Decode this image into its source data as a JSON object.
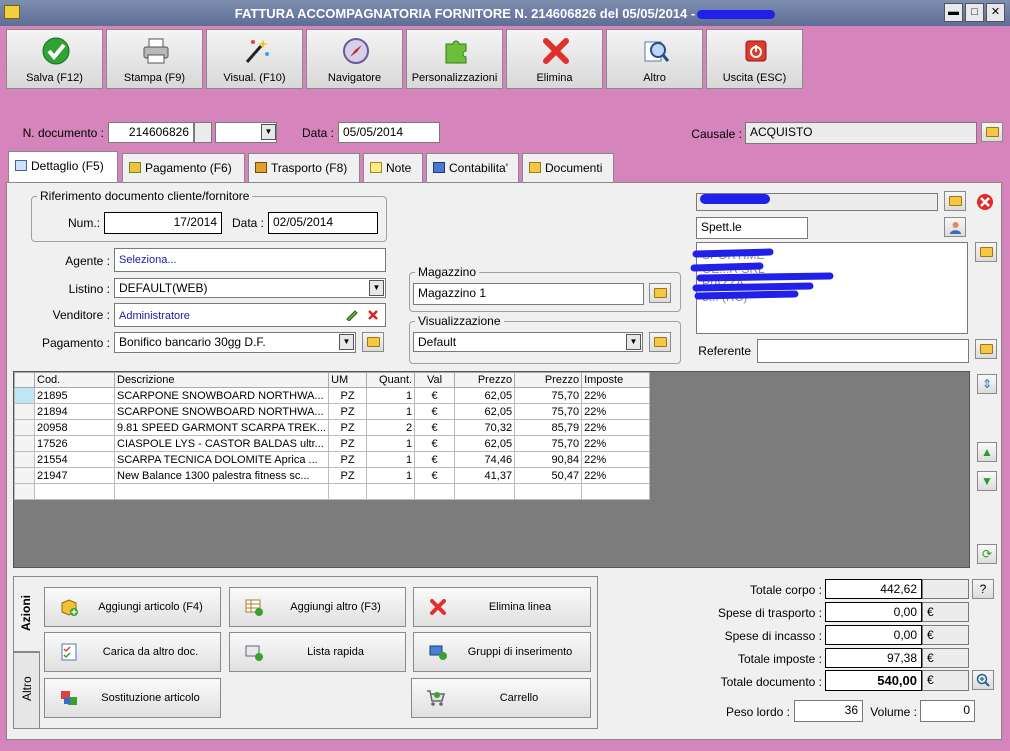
{
  "window": {
    "title": "FATTURA ACCOMPAGNATORIA FORNITORE N. 214606826 del 05/05/2014 -",
    "minimize": "▬",
    "maximize": "□",
    "close": "✕"
  },
  "toolbar": {
    "save": "Salva (F12)",
    "print": "Stampa (F9)",
    "view": "Visual. (F10)",
    "navigator": "Navigatore",
    "customize": "Personalizzazioni",
    "delete": "Elimina",
    "other": "Altro",
    "exit": "Uscita (ESC)"
  },
  "header": {
    "doc_number_label": "N. documento :",
    "doc_number": "214606826",
    "series": "",
    "date_label": "Data :",
    "date": "05/05/2014",
    "causale_label": "Causale :",
    "causale": "ACQUISTO"
  },
  "tabs": [
    {
      "label": "Dettaglio (F5)"
    },
    {
      "label": "Pagamento (F6)"
    },
    {
      "label": "Trasporto (F8)"
    },
    {
      "label": "Note"
    },
    {
      "label": "Contabilita'"
    },
    {
      "label": "Documenti"
    }
  ],
  "reference_doc": {
    "title": "Riferimento documento cliente/fornitore",
    "num_label": "Num.:",
    "num": "17/2014",
    "date_label": "Data :",
    "date": "02/05/2014"
  },
  "form": {
    "agent_label": "Agente :",
    "agent": "Seleziona...",
    "list_label": "Listino :",
    "list": "DEFAULT(WEB)",
    "seller_label": "Venditore :",
    "seller": "Administratore",
    "payment_label": "Pagamento :",
    "payment": "Bonifico bancario 30gg D.F."
  },
  "warehouse": {
    "title": "Magazzino",
    "value": "Magazzino 1"
  },
  "visualization": {
    "title": "Visualizzazione",
    "value": "Default"
  },
  "customer": {
    "salutation": "Spett.le",
    "address_lines": [
      "SPORTIME",
      "GE...R SRL",
      "PIAZZA ...",
      "8... (RC)"
    ],
    "referente_label": "Referente",
    "referente": ""
  },
  "grid": {
    "columns": [
      "Cod.",
      "Descrizione",
      "UM",
      "Quant.",
      "Val",
      "Prezzo",
      "Prezzo",
      "Imposte"
    ],
    "rows": [
      [
        "21895",
        "SCARPONE SNOWBOARD NORTHWA...",
        "PZ",
        "1",
        "€",
        "62,05",
        "75,70",
        "22%"
      ],
      [
        "21894",
        "SCARPONE SNOWBOARD NORTHWA...",
        "PZ",
        "1",
        "€",
        "62,05",
        "75,70",
        "22%"
      ],
      [
        "20958",
        "9.81 SPEED GARMONT SCARPA TREK...",
        "PZ",
        "2",
        "€",
        "70,32",
        "85,79",
        "22%"
      ],
      [
        "17526",
        "CIASPOLE LYS - CASTOR BALDAS ultr...",
        "PZ",
        "1",
        "€",
        "62,05",
        "75,70",
        "22%"
      ],
      [
        "21554",
        "SCARPA TECNICA DOLOMITE Aprica ...",
        "PZ",
        "1",
        "€",
        "74,46",
        "90,84",
        "22%"
      ],
      [
        "21947",
        "New Balance 1300 palestra fitness sc...",
        "PZ",
        "1",
        "€",
        "41,37",
        "50,47",
        "22%"
      ],
      [
        "",
        "",
        "",
        "",
        "",
        "",
        "",
        ""
      ]
    ]
  },
  "actions": {
    "tab_actions": "Azioni",
    "tab_other": "Altro",
    "add_item": "Aggiungi articolo (F4)",
    "add_other": "Aggiungi altro (F3)",
    "delete_line": "Elimina linea",
    "load_other_doc": "Carica da altro doc.",
    "quick_list": "Lista rapida",
    "insert_groups": "Gruppi di inserimento",
    "replace_item": "Sostituzione articolo",
    "cart": "Carrello"
  },
  "totals": {
    "body_label": "Totale corpo :",
    "body": "442,62",
    "help": "?",
    "shipping_label": "Spese di trasporto :",
    "shipping": "0,00",
    "collection_label": "Spese di incasso :",
    "collection": "0,00",
    "tax_label": "Totale imposte :",
    "tax": "97,38",
    "doc_label": "Totale documento :",
    "doc": "540,00",
    "currency": "€",
    "weight_label": "Peso lordo :",
    "weight": "36",
    "volume_label": "Volume :",
    "volume": "0"
  }
}
